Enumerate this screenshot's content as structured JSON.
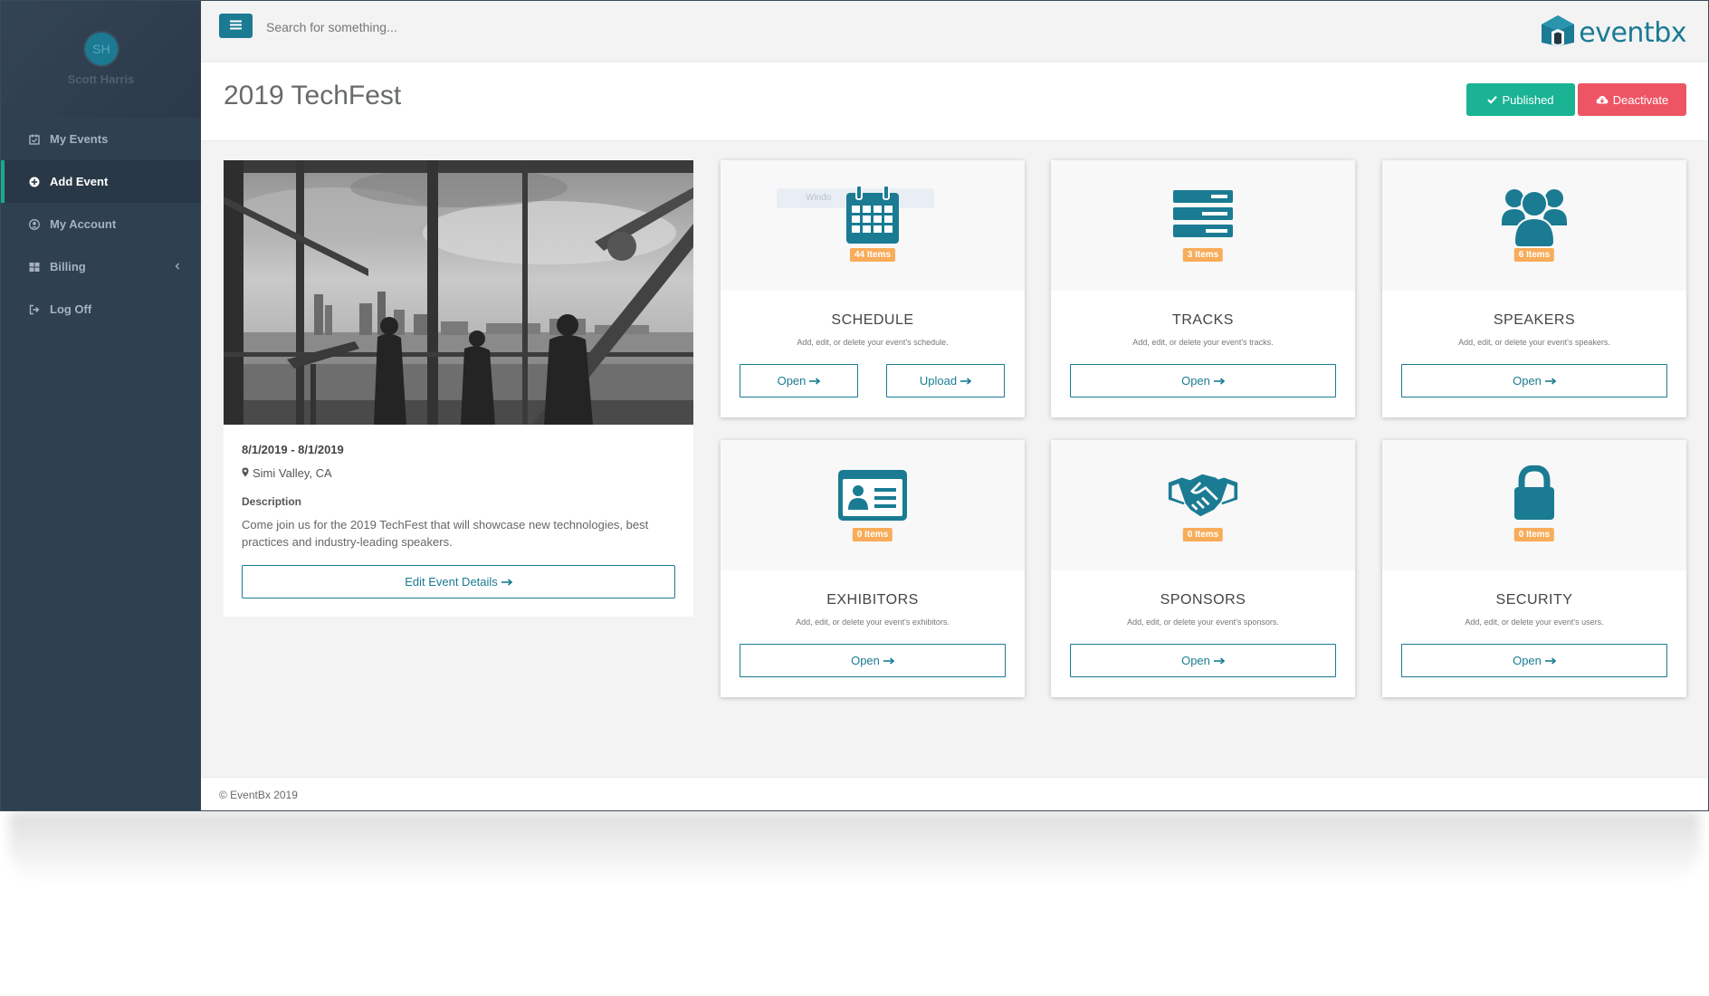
{
  "user": {
    "initials": "SH",
    "name": "Scott Harris"
  },
  "sidebar": {
    "items": [
      {
        "label": "My Events",
        "icon": "calendar-check-icon",
        "active": false
      },
      {
        "label": "Add Event",
        "icon": "plus-circle-icon",
        "active": true
      },
      {
        "label": "My Account",
        "icon": "user-circle-icon",
        "active": false
      },
      {
        "label": "Billing",
        "icon": "grid-icon",
        "active": false,
        "has_submenu": true
      },
      {
        "label": "Log Off",
        "icon": "sign-out-icon",
        "active": false
      }
    ]
  },
  "topbar": {
    "search_placeholder": "Search for something...",
    "logo_text": "eventbx"
  },
  "page": {
    "title": "2019 TechFest",
    "published_label": "Published",
    "deactivate_label": "Deactivate"
  },
  "event": {
    "dates": "8/1/2019 - 8/1/2019",
    "location": "Simi Valley, CA",
    "description_label": "Description",
    "description": "Come join us for the 2019 TechFest that will showcase new technologies, best practices and industry-leading speakers.",
    "edit_button": "Edit Event Details"
  },
  "modules": [
    {
      "title": "SCHEDULE",
      "badge": "44 Items",
      "description": "Add, edit, or delete your event's schedule.",
      "open_label": "Open",
      "upload_label": "Upload",
      "icon": "calendar-icon"
    },
    {
      "title": "TRACKS",
      "badge": "3 Items",
      "description": "Add, edit, or delete your event's tracks.",
      "open_label": "Open",
      "icon": "server-icon"
    },
    {
      "title": "SPEAKERS",
      "badge": "6 Items",
      "description": "Add, edit, or delete your event's speakers.",
      "open_label": "Open",
      "icon": "users-icon"
    },
    {
      "title": "EXHIBITORS",
      "badge": "0 Items",
      "description": "Add, edit, or delete your event's exhibitors.",
      "open_label": "Open",
      "icon": "id-card-icon"
    },
    {
      "title": "SPONSORS",
      "badge": "0 Items",
      "description": "Add, edit, or delete your event's sponsors.",
      "open_label": "Open",
      "icon": "handshake-icon"
    },
    {
      "title": "SECURITY",
      "badge": "0 Items",
      "description": "Add, edit, or delete your event's users.",
      "open_label": "Open",
      "icon": "lock-icon"
    }
  ],
  "footer": {
    "text": "© EventBx 2019"
  },
  "colors": {
    "primary": "#1a7b93",
    "sidebar": "#2f4050",
    "published": "#1ab394",
    "deactivate": "#ed5565",
    "badge": "#f8ac59"
  }
}
